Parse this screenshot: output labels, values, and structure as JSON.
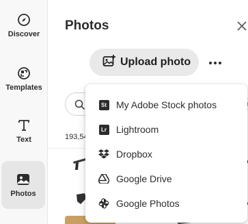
{
  "rail": {
    "items": [
      {
        "label": "Discover",
        "icon": "compass-icon"
      },
      {
        "label": "Templates",
        "icon": "templates-icon"
      },
      {
        "label": "Text",
        "icon": "text-icon"
      },
      {
        "label": "Photos",
        "icon": "photos-icon",
        "active": true
      }
    ]
  },
  "panel": {
    "title": "Photos",
    "upload_label": "Upload photo",
    "search_placeholder": "",
    "result_count": "193,54"
  },
  "menu": {
    "items": [
      {
        "label": "My Adobe Stock photos",
        "icon": "adobe-stock-icon",
        "badge": "St"
      },
      {
        "label": "Lightroom",
        "icon": "lightroom-icon",
        "badge": "Lr"
      },
      {
        "label": "Dropbox",
        "icon": "dropbox-icon"
      },
      {
        "label": "Google Drive",
        "icon": "google-drive-icon"
      },
      {
        "label": "Google Photos",
        "icon": "google-photos-icon"
      }
    ]
  },
  "colors": {
    "rail_bg": "#f8f8f8",
    "active_bg": "#e6e6e6",
    "button_bg": "#e9e9e9",
    "text": "#2c2c2c"
  }
}
